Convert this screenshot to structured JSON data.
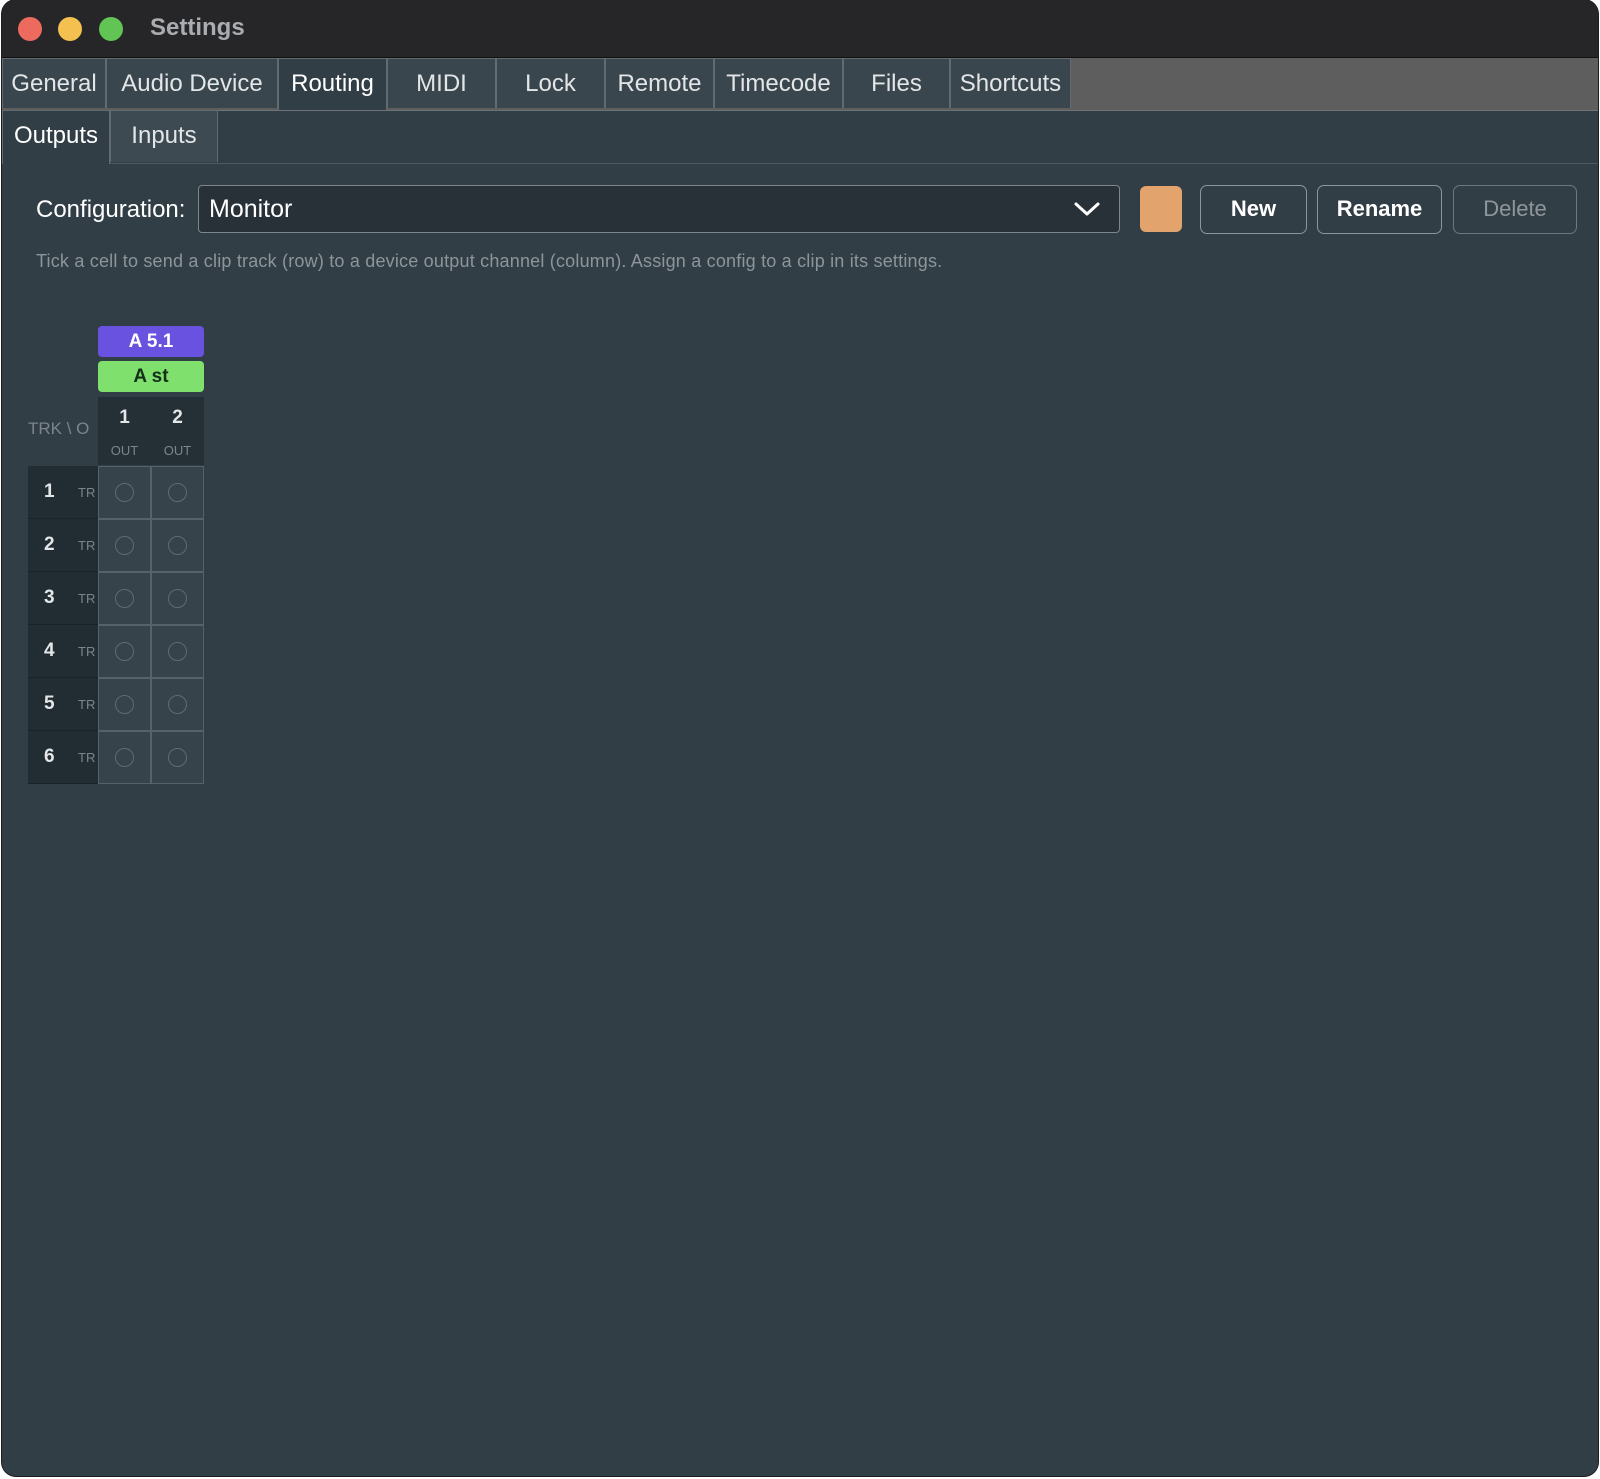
{
  "window": {
    "title": "Settings"
  },
  "tabs": [
    {
      "label": "General",
      "active": false
    },
    {
      "label": "Audio Device",
      "active": false
    },
    {
      "label": "Routing",
      "active": true
    },
    {
      "label": "MIDI",
      "active": false
    },
    {
      "label": "Lock",
      "active": false
    },
    {
      "label": "Remote",
      "active": false
    },
    {
      "label": "Timecode",
      "active": false
    },
    {
      "label": "Files",
      "active": false
    },
    {
      "label": "Shortcuts",
      "active": false
    }
  ],
  "subtabs": [
    {
      "label": "Outputs",
      "active": true
    },
    {
      "label": "Inputs",
      "active": false
    }
  ],
  "configuration": {
    "label": "Configuration:",
    "value": "Monitor",
    "color": "#e2a46c"
  },
  "buttons": {
    "new": "New",
    "rename": "Rename",
    "delete": "Delete"
  },
  "hint": "Tick a cell to send a clip track (row) to a device output channel (column). Assign a config to a clip in its settings.",
  "grid": {
    "corner_label": "TRK \\ O",
    "groups": [
      {
        "label": "A 5.1",
        "color": "#6a52e0",
        "text_color": "#ffffff"
      },
      {
        "label": "A st",
        "color": "#7fe06d",
        "text_color": "#13301a"
      }
    ],
    "columns": [
      {
        "number": "1",
        "sub": "OUT"
      },
      {
        "number": "2",
        "sub": "OUT"
      }
    ],
    "rows": [
      {
        "number": "1",
        "sub": "TR",
        "cells": [
          false,
          false
        ]
      },
      {
        "number": "2",
        "sub": "TR",
        "cells": [
          false,
          false
        ]
      },
      {
        "number": "3",
        "sub": "TR",
        "cells": [
          false,
          false
        ]
      },
      {
        "number": "4",
        "sub": "TR",
        "cells": [
          false,
          false
        ]
      },
      {
        "number": "5",
        "sub": "TR",
        "cells": [
          false,
          false
        ]
      },
      {
        "number": "6",
        "sub": "TR",
        "cells": [
          false,
          false
        ]
      }
    ]
  }
}
